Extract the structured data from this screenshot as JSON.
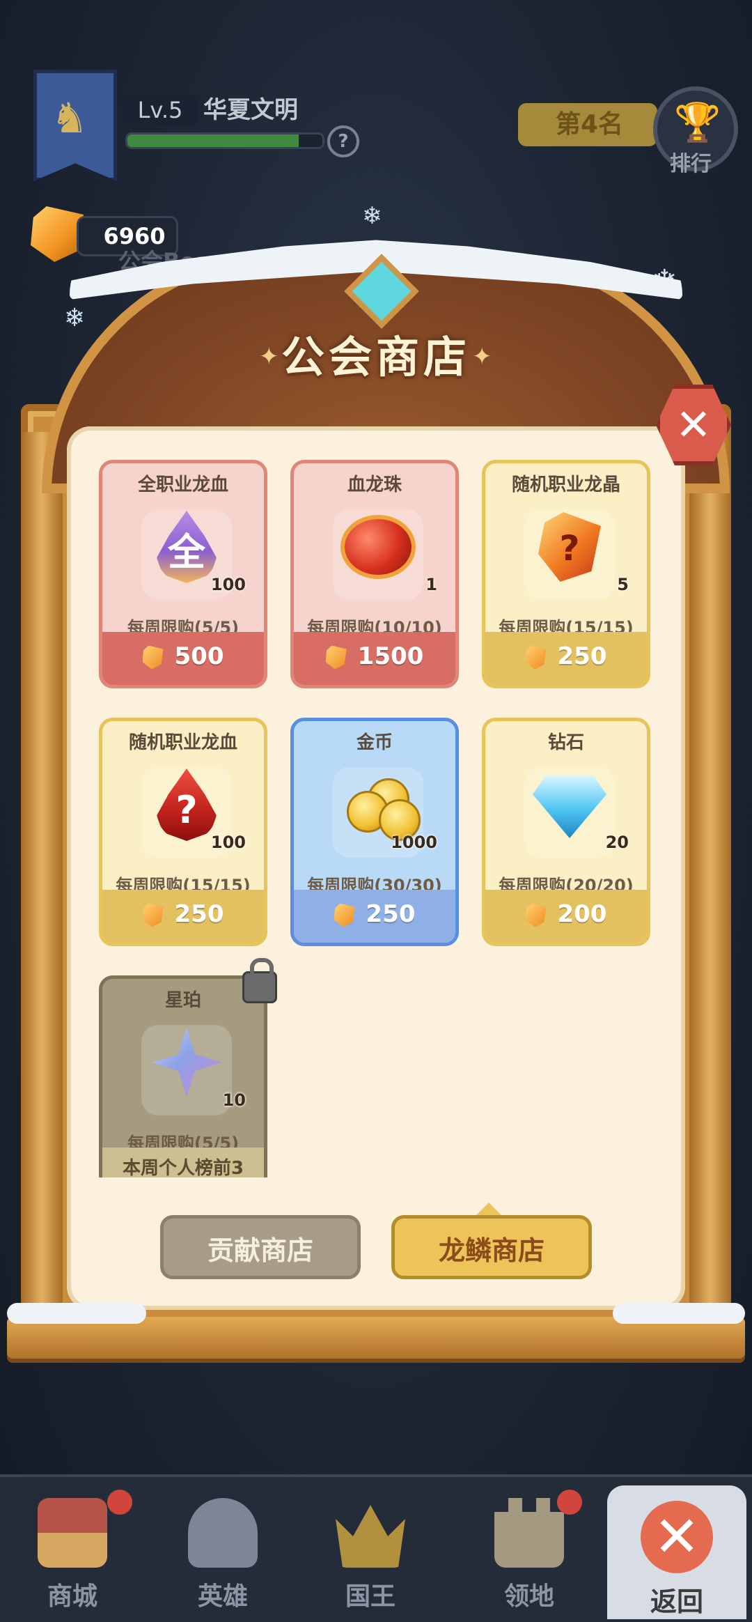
{
  "hud": {
    "level": "Lv.5",
    "guild_name": "华夏文明",
    "xp_progress": 0.88,
    "help_symbol": "?",
    "rank_text": "第4名",
    "rank_label": "排行",
    "currency_amount": "6960",
    "background_label": "公会Boss"
  },
  "shop": {
    "title": "公会商店",
    "close_symbol": "✕",
    "items": [
      {
        "name": "全职业龙血",
        "icon": "purple-dragon-blood-icon",
        "icon_char": "全",
        "qty": "100",
        "limit": "每周限购(5/5)",
        "price": "500",
        "style": "pink"
      },
      {
        "name": "血龙珠",
        "icon": "blood-dragon-orb-icon",
        "qty": "1",
        "limit": "每周限购(10/10)",
        "price": "1500",
        "style": "pink"
      },
      {
        "name": "随机职业龙晶",
        "icon": "random-dragon-crystal-icon",
        "icon_char": "?",
        "qty": "5",
        "limit": "每周限购(15/15)",
        "price": "250",
        "style": "gold"
      },
      {
        "name": "随机职业龙血",
        "icon": "random-dragon-blood-icon",
        "icon_char": "?",
        "qty": "100",
        "limit": "每周限购(15/15)",
        "price": "250",
        "style": "gold"
      },
      {
        "name": "金币",
        "icon": "gold-coins-icon",
        "qty": "1000",
        "limit": "每周限购(30/30)",
        "price": "250",
        "style": "blue"
      },
      {
        "name": "钻石",
        "icon": "diamond-icon",
        "qty": "20",
        "limit": "每周限购(20/20)",
        "price": "200",
        "style": "gold"
      },
      {
        "name": "星珀",
        "icon": "star-amber-icon",
        "qty": "10",
        "limit": "每周限购(5/5)",
        "requirement": "本周个人榜前3",
        "style": "grey",
        "locked": true
      }
    ],
    "tabs": {
      "contribution": "贡献商店",
      "dragon_scale": "龙鳞商店"
    }
  },
  "nav": {
    "items": [
      {
        "label": "商城",
        "icon": "shop-icon",
        "badge": true
      },
      {
        "label": "英雄",
        "icon": "hero-helmet-icon",
        "badge": false
      },
      {
        "label": "国王",
        "icon": "crown-icon",
        "badge": false
      },
      {
        "label": "领地",
        "icon": "castle-icon",
        "badge": true
      }
    ],
    "return_label": "返回",
    "return_symbol": "✕"
  },
  "colors": {
    "accent_gold": "#edc45a",
    "card_pink": "#f6d3cc",
    "card_blue": "#b9daf6",
    "badge_red": "#d2453c"
  }
}
